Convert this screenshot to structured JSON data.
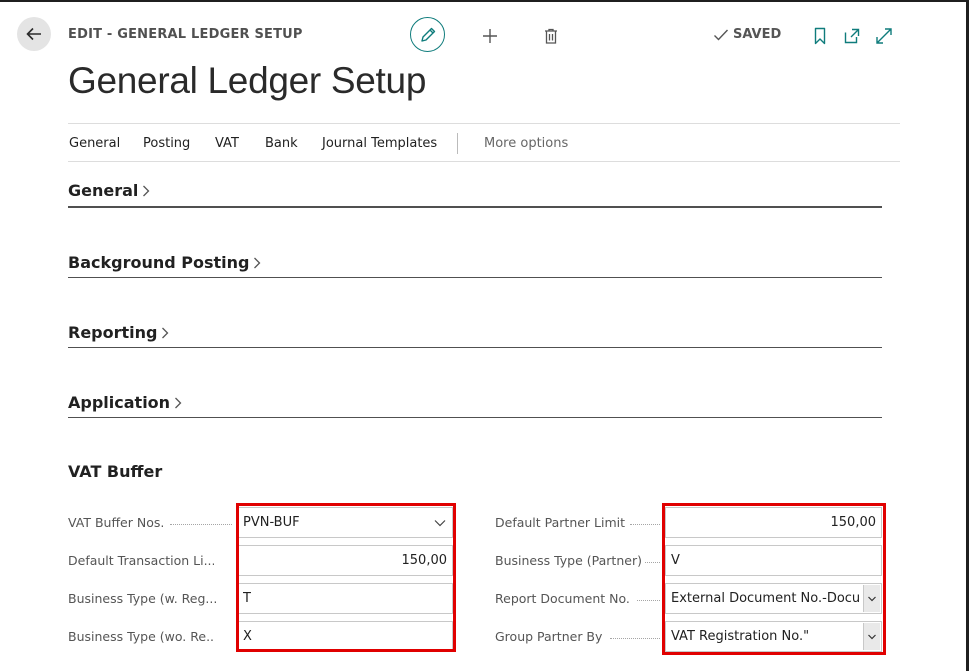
{
  "header": {
    "caption": "EDIT - GENERAL LEDGER SETUP",
    "saved_label": "SAVED",
    "title": "General Ledger Setup"
  },
  "actions": [
    "General",
    "Posting",
    "VAT",
    "Bank",
    "Journal Templates"
  ],
  "more_options": "More options",
  "sections": {
    "general": "General",
    "background_posting": "Background Posting",
    "reporting": "Reporting",
    "application": "Application",
    "vat_buffer": "VAT Buffer"
  },
  "vat_buffer": {
    "left": [
      {
        "label": "VAT Buffer Nos.",
        "value": "PVN-BUF"
      },
      {
        "label": "Default Transaction Li...",
        "value": "150,00"
      },
      {
        "label": "Business Type (w. Reg....",
        "value": "T"
      },
      {
        "label": "Business Type (wo. Re...",
        "value": "X"
      }
    ],
    "right": [
      {
        "label": "Default Partner Limit",
        "value": "150,00"
      },
      {
        "label": "Business Type (Partner)",
        "value": "V"
      },
      {
        "label": "Report Document No.",
        "value": "External Document No.-Document No."
      },
      {
        "label": "Group Partner By",
        "value": "VAT Registration No.\""
      }
    ]
  },
  "icons": {
    "back": "back-arrow-icon",
    "edit": "pencil-icon",
    "new": "plus-icon",
    "delete": "trash-icon",
    "saved": "checkmark-icon",
    "bookmark": "bookmark-icon",
    "open_new_window": "open-in-new-window-icon",
    "expand": "expand-icon"
  },
  "colors": {
    "accent": "#0f7c7c",
    "highlight_box": "#e00000"
  }
}
